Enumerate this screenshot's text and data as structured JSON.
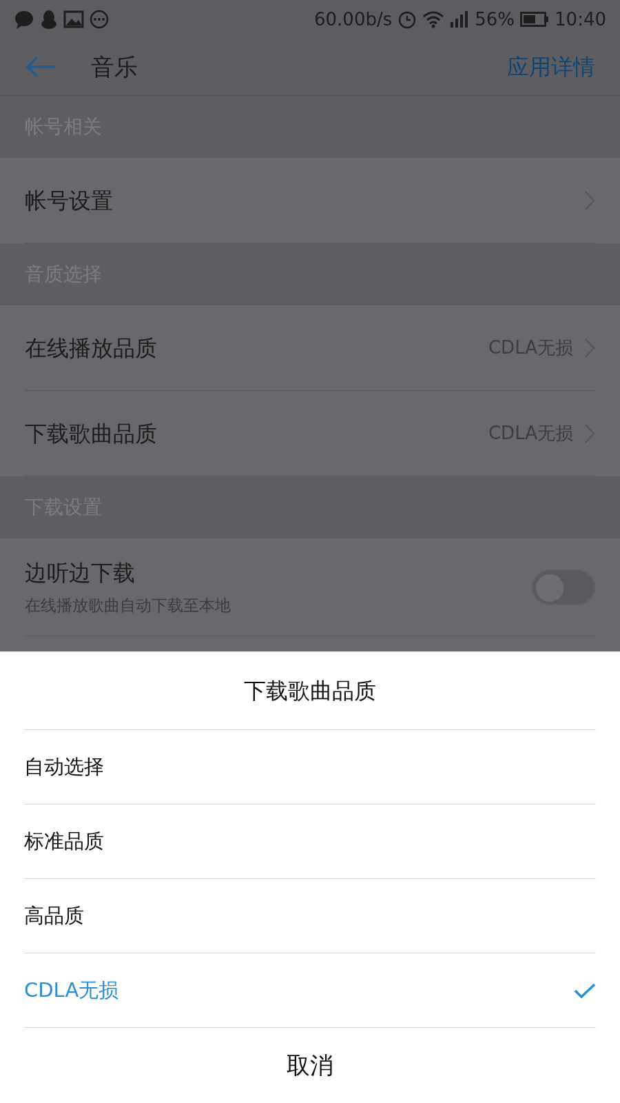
{
  "status_bar": {
    "speed": "60.00b/s",
    "battery": "56%",
    "time": "10:40"
  },
  "header": {
    "title": "音乐",
    "action": "应用详情"
  },
  "sections": [
    {
      "title": "帐号相关",
      "items": [
        {
          "kind": "link",
          "label": "帐号设置"
        }
      ]
    },
    {
      "title": "音质选择",
      "items": [
        {
          "kind": "link",
          "label": "在线播放品质",
          "value": "CDLA无损"
        },
        {
          "kind": "link",
          "label": "下载歌曲品质",
          "value": "CDLA无损"
        }
      ]
    },
    {
      "title": "下载设置",
      "items": [
        {
          "kind": "toggle",
          "label": "边听边下载",
          "subtitle": "在线播放歌曲自动下载至本地",
          "on": false
        }
      ]
    }
  ],
  "dialog": {
    "title": "下载歌曲品质",
    "options": [
      {
        "label": "自动选择",
        "selected": false
      },
      {
        "label": "标准品质",
        "selected": false
      },
      {
        "label": "高品质",
        "selected": false
      },
      {
        "label": "CDLA无损",
        "selected": true
      }
    ],
    "cancel": "取消"
  }
}
